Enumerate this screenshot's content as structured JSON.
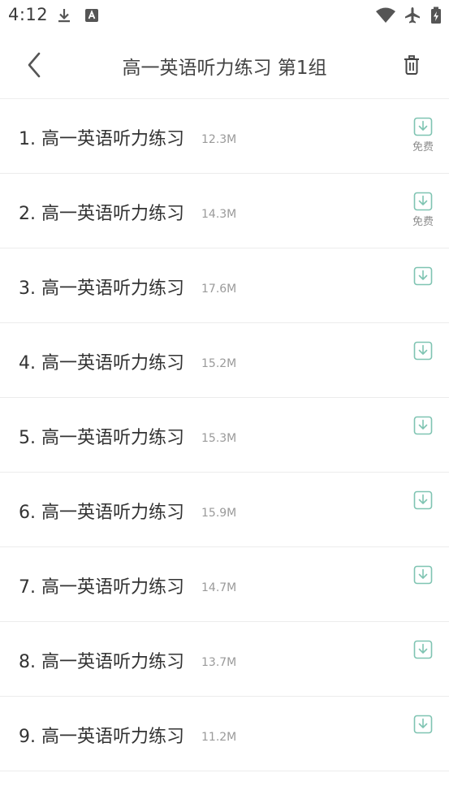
{
  "status_bar": {
    "time": "4:12",
    "icons": [
      "download-icon",
      "text-recognition-icon",
      "wifi-icon",
      "airplane-mode-icon",
      "battery-charging-icon"
    ]
  },
  "header": {
    "back_icon": "chevron-left-icon",
    "title": "高一英语听力练习 第1组",
    "delete_icon": "trash-icon"
  },
  "colors": {
    "accent": "#7fc4b2",
    "text_primary": "#333333",
    "text_secondary": "#9a9a9a",
    "divider": "#ececec"
  },
  "tracks": [
    {
      "title": "1. 高一英语听力练习",
      "size": "12.3M",
      "free_label": "免费"
    },
    {
      "title": "2. 高一英语听力练习",
      "size": "14.3M",
      "free_label": "免费"
    },
    {
      "title": "3. 高一英语听力练习",
      "size": "17.6M",
      "free_label": ""
    },
    {
      "title": "4. 高一英语听力练习",
      "size": "15.2M",
      "free_label": ""
    },
    {
      "title": "5. 高一英语听力练习",
      "size": "15.3M",
      "free_label": ""
    },
    {
      "title": "6. 高一英语听力练习",
      "size": "15.9M",
      "free_label": ""
    },
    {
      "title": "7. 高一英语听力练习",
      "size": "14.7M",
      "free_label": ""
    },
    {
      "title": "8. 高一英语听力练习",
      "size": "13.7M",
      "free_label": ""
    },
    {
      "title": "9. 高一英语听力练习",
      "size": "11.2M",
      "free_label": ""
    }
  ]
}
